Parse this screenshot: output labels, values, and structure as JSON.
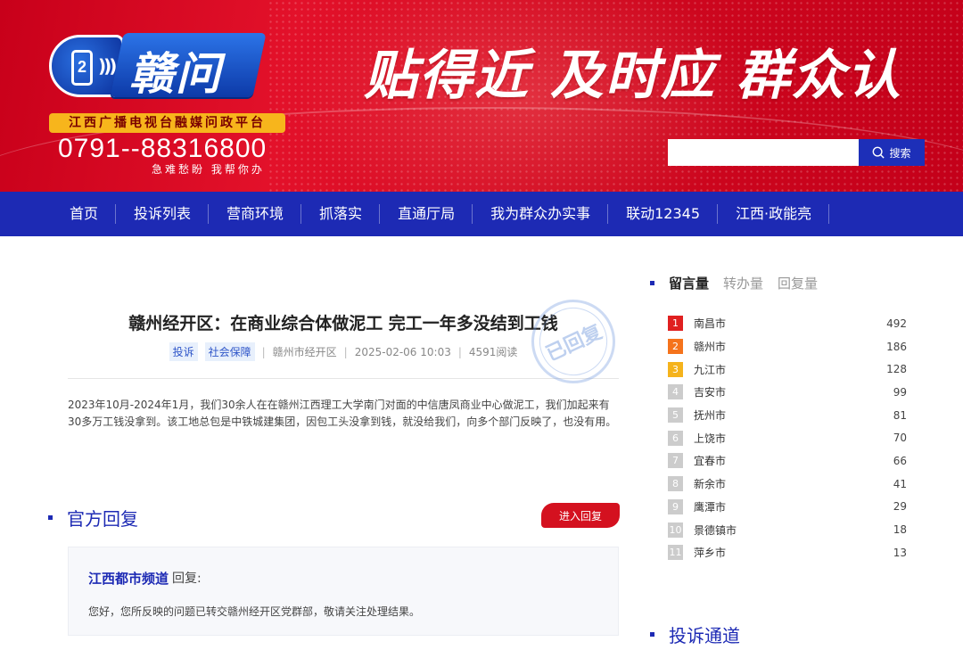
{
  "banner": {
    "logo_phone_digit": "2",
    "logo_name": "赣问",
    "platform_tag": "江西广播电视台融媒问政平台",
    "hotline": "0791--88316800",
    "slogan": "急难愁盼  我帮你办",
    "headline": "贴得近  及时应  群众认"
  },
  "search": {
    "value": "",
    "placeholder": "",
    "button_label": "搜索"
  },
  "nav": {
    "items": [
      "首页",
      "投诉列表",
      "营商环境",
      "抓落实",
      "直通厅局",
      "我为群众办实事",
      "联动12345",
      "江西·政能亮"
    ]
  },
  "article": {
    "title": "赣州经开区：在商业综合体做泥工 完工一年多没结到工钱",
    "tags": [
      "投诉",
      "社会保障"
    ],
    "location": "赣州市经开区",
    "datetime": "2025-02-06 10:03",
    "reads": "4591阅读",
    "stamp": "已回复",
    "body": "2023年10月-2024年1月，我们30余人在在赣州江西理工大学南门对面的中信唐凤商业中心做泥工，我们加起来有30多万工钱没拿到。该工地总包是中铁城建集团，因包工头没拿到钱，就没给我们，向多个部门反映了，也没有用。"
  },
  "official_reply": {
    "section_title": "官方回复",
    "enter_button": "进入回复",
    "org": "江西都市频道",
    "suffix": "回复:",
    "text": "您好，您所反映的问题已转交赣州经开区党群部，敬请关注处理结果。"
  },
  "sidebar": {
    "tabs": [
      "留言量",
      "转办量",
      "回复量"
    ],
    "ranking": [
      {
        "rank": "1",
        "city": "南昌市",
        "count": "492",
        "color": "#e02020"
      },
      {
        "rank": "2",
        "city": "赣州市",
        "count": "186",
        "color": "#f5731c"
      },
      {
        "rank": "3",
        "city": "九江市",
        "count": "128",
        "color": "#f5b31c"
      },
      {
        "rank": "4",
        "city": "吉安市",
        "count": "99",
        "color": "#cccccc"
      },
      {
        "rank": "5",
        "city": "抚州市",
        "count": "81",
        "color": "#cccccc"
      },
      {
        "rank": "6",
        "city": "上饶市",
        "count": "70",
        "color": "#cccccc"
      },
      {
        "rank": "7",
        "city": "宜春市",
        "count": "66",
        "color": "#cccccc"
      },
      {
        "rank": "8",
        "city": "新余市",
        "count": "41",
        "color": "#cccccc"
      },
      {
        "rank": "9",
        "city": "鹰潭市",
        "count": "29",
        "color": "#cccccc"
      },
      {
        "rank": "10",
        "city": "景德镇市",
        "count": "18",
        "color": "#cccccc"
      },
      {
        "rank": "11",
        "city": "萍乡市",
        "count": "13",
        "color": "#cccccc"
      }
    ],
    "section2_title": "投诉通道"
  },
  "colors": {
    "brand_blue": "#1d2ab4",
    "brand_red": "#d4111f"
  }
}
